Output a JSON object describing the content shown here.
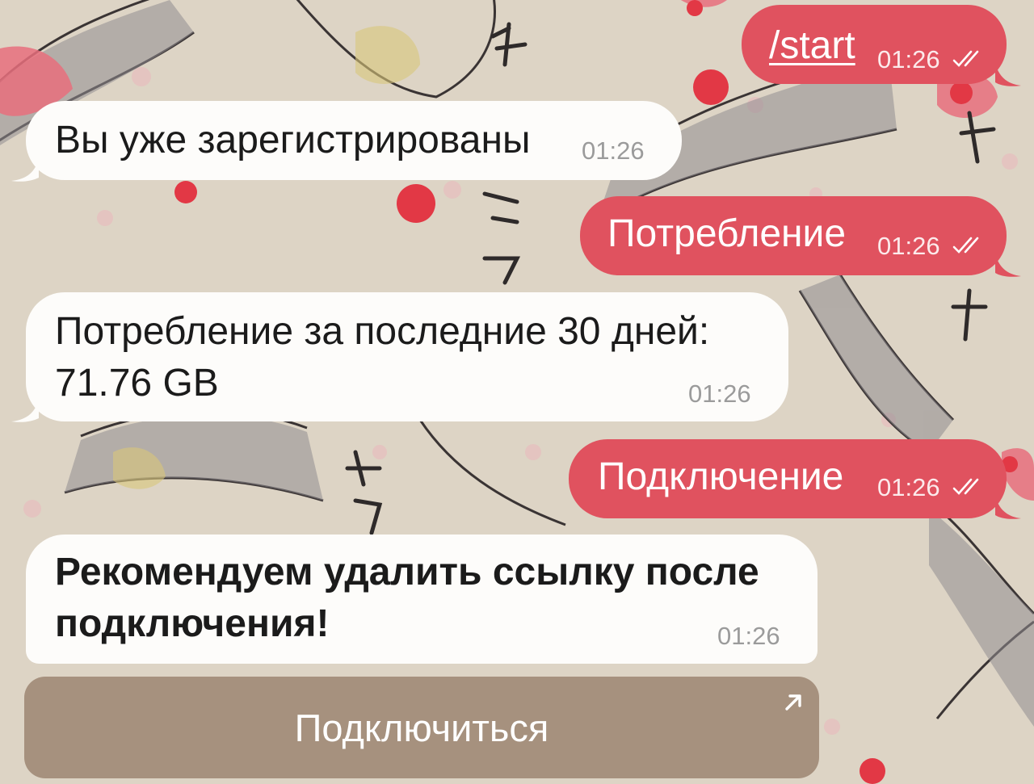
{
  "chat": {
    "messages": [
      {
        "direction": "outgoing",
        "text": "/start",
        "is_command": true,
        "time": "01:26",
        "status": "read"
      },
      {
        "direction": "incoming",
        "text": "Вы уже зарегистрированы",
        "time": "01:26"
      },
      {
        "direction": "outgoing",
        "text": "Потребление",
        "time": "01:26",
        "status": "read"
      },
      {
        "direction": "incoming",
        "lines": [
          "Потребление за последние 30 дней:",
          "71.76 GB"
        ],
        "time": "01:26"
      },
      {
        "direction": "outgoing",
        "text": "Подключение",
        "time": "01:26",
        "status": "read"
      },
      {
        "direction": "incoming",
        "lines": [
          "Рекомендуем удалить ссылку после",
          "подключения!"
        ],
        "bold": true,
        "time": "01:26"
      }
    ]
  },
  "inline_keyboard": {
    "button_label": "Подключиться",
    "icon": "external-link-arrow-icon"
  },
  "theme": {
    "outgoing_bubble": "#e0525f",
    "incoming_bubble": "#fdfcfa",
    "wallpaper": "#ddd4c5",
    "button": "#967e6a"
  }
}
